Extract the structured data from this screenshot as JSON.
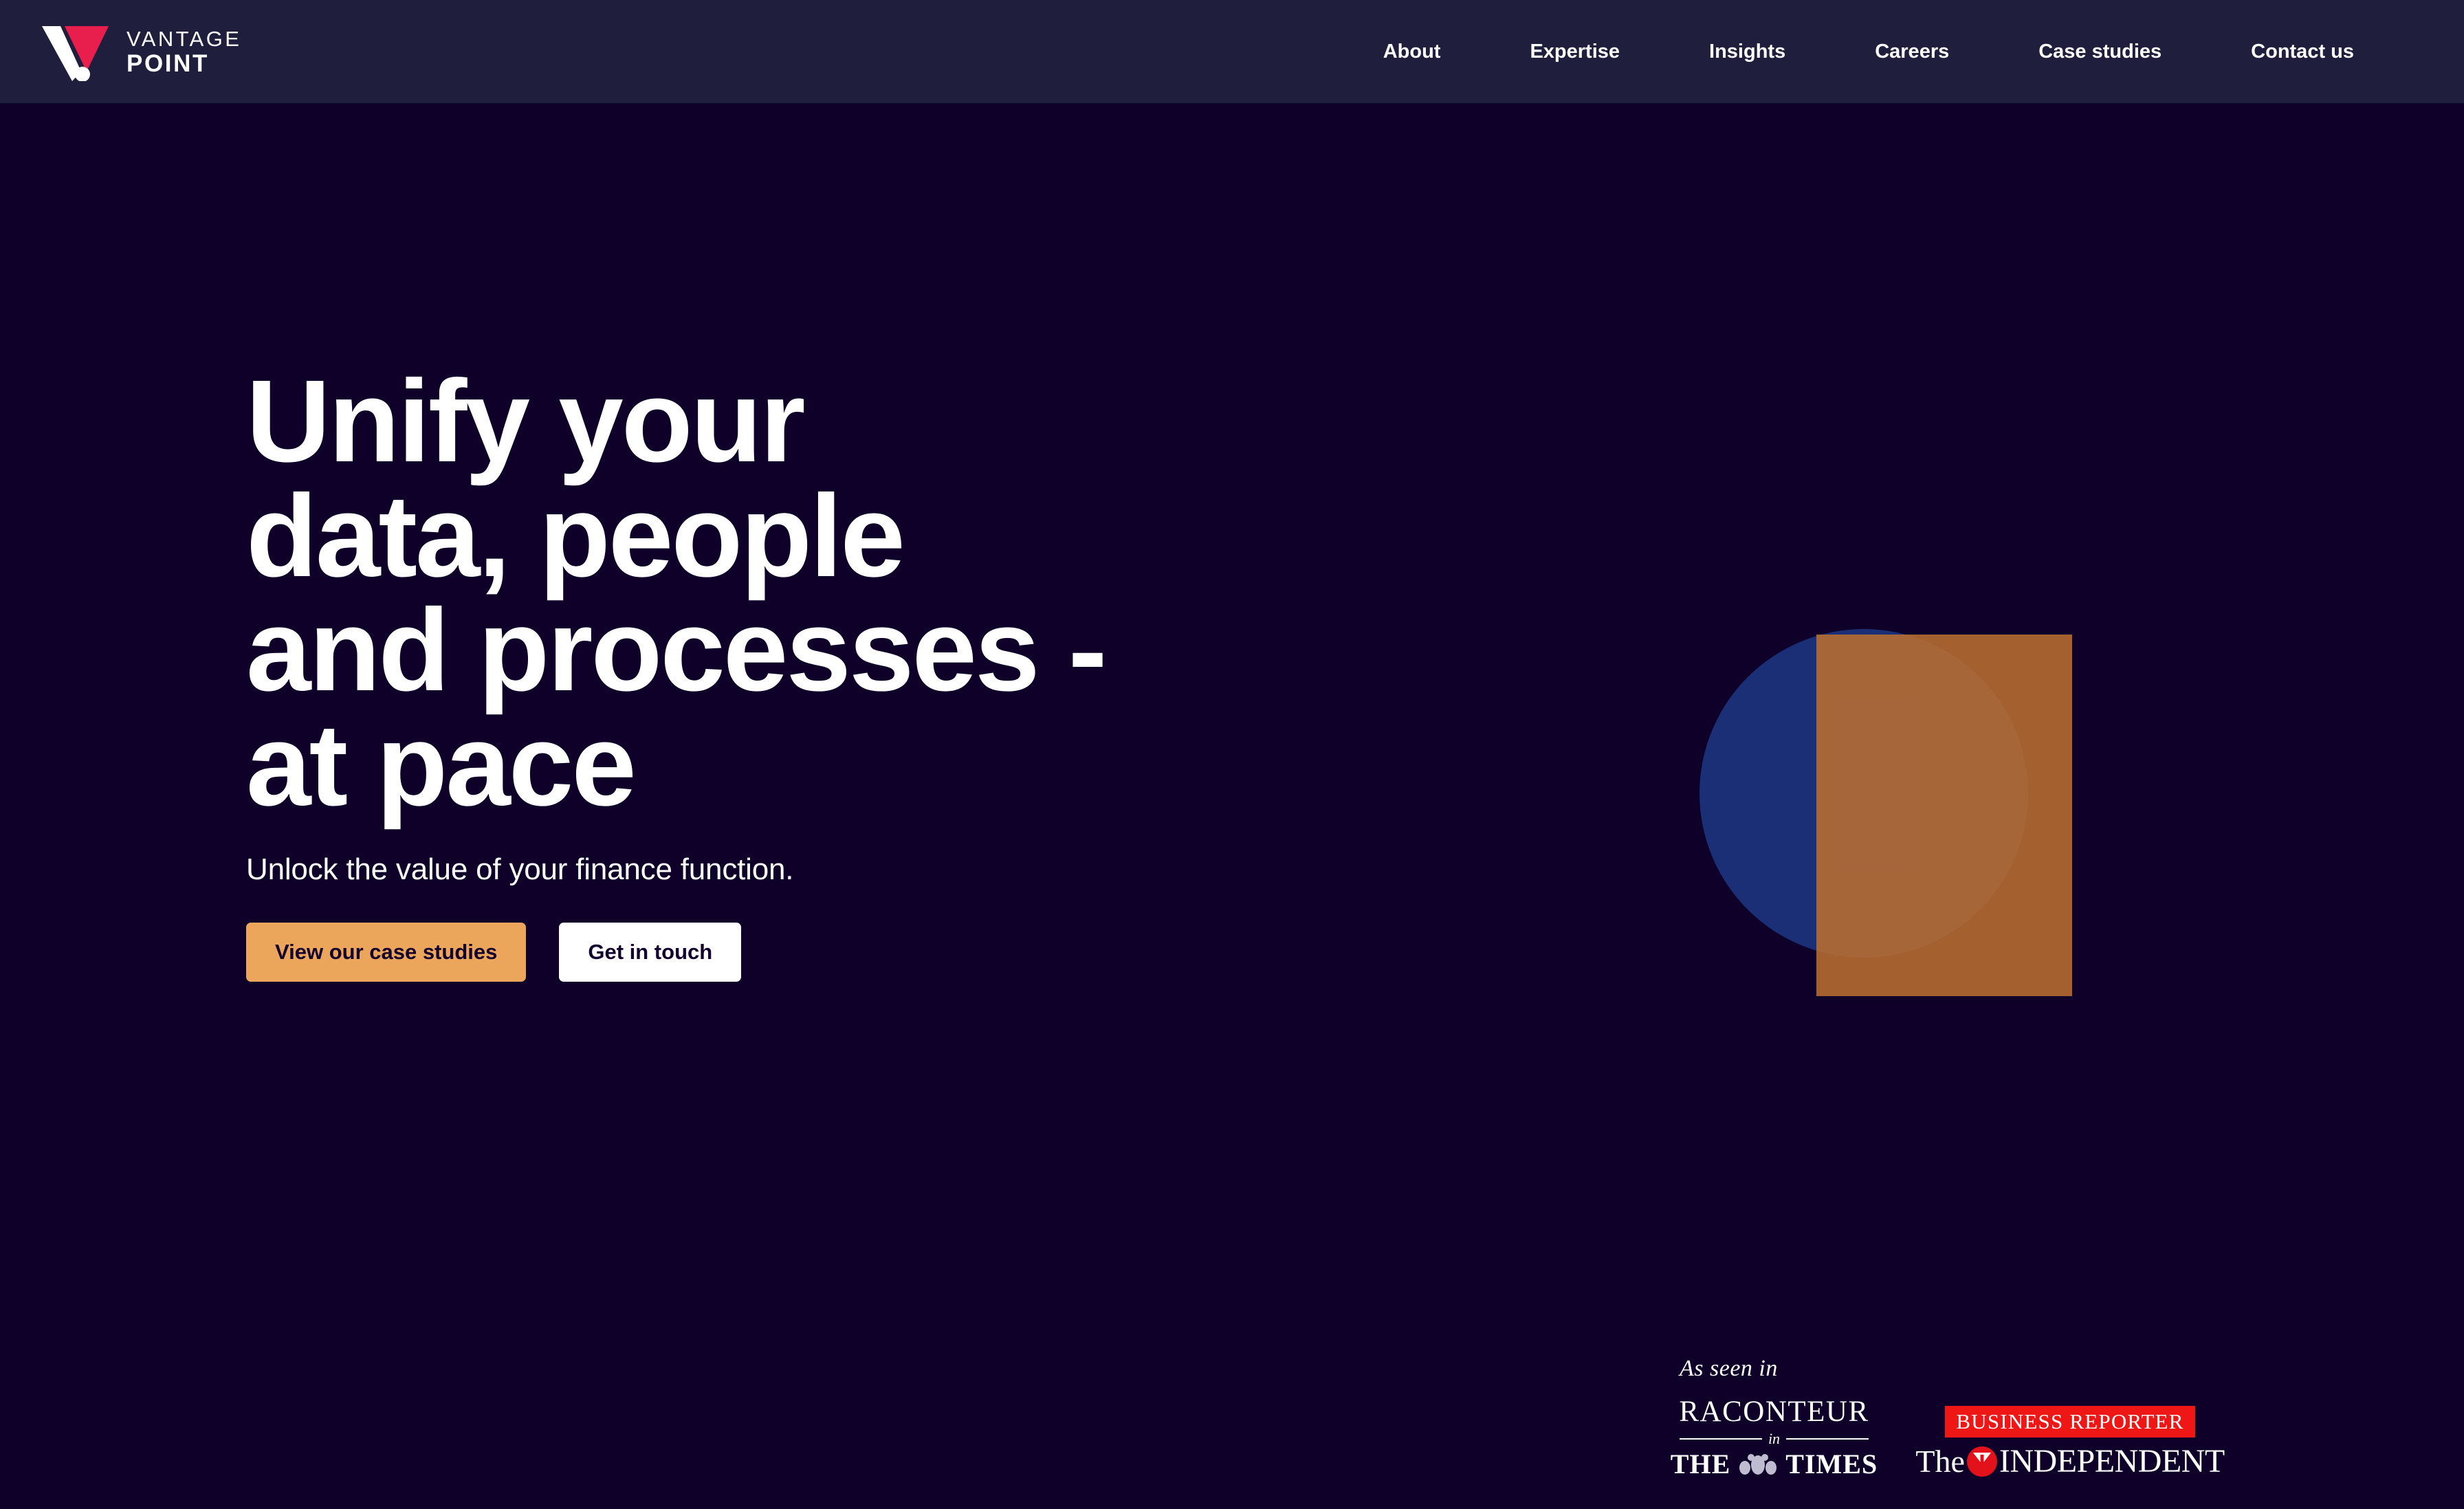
{
  "brand": {
    "line1": "VANTAGE",
    "line2": "POINT",
    "logo_icon": "vantage-point-v-mark",
    "colors": {
      "red": "#e81e4d",
      "white": "#ffffff"
    }
  },
  "header": {
    "background": "#1f1f3d",
    "nav": [
      {
        "label": "About"
      },
      {
        "label": "Expertise"
      },
      {
        "label": "Insights"
      },
      {
        "label": "Careers"
      },
      {
        "label": "Case studies"
      },
      {
        "label": "Contact us"
      }
    ]
  },
  "hero": {
    "background": "#0e0028",
    "title": "Unify your\ndata, people\nand processes -\nat pace",
    "subtitle": "Unlock the value of your finance function.",
    "buttons": {
      "primary": {
        "label": "View our case studies",
        "background": "#eca65c",
        "color": "#14002e"
      },
      "secondary": {
        "label": "Get in touch",
        "background": "#ffffff",
        "color": "#14002e"
      }
    },
    "graphic": {
      "circle_color": "#1a2f76",
      "square_color": "#b96e30",
      "blend_color": "#ab8a6b"
    }
  },
  "as_seen_in": {
    "label": "As seen in",
    "logos": [
      {
        "name": "raconteur-in-the-times",
        "word": "RACONTEUR",
        "connector": "in",
        "publication_left": "THE",
        "publication_right": "TIMES",
        "crest_icon": "times-royal-crest"
      },
      {
        "name": "business-reporter-the-independent",
        "badge": "BUSINESS REPORTER",
        "badge_color": "#ef1616",
        "the": "The",
        "mark_icon": "independent-eagle-icon",
        "word": "INDEPENDENT"
      }
    ]
  }
}
